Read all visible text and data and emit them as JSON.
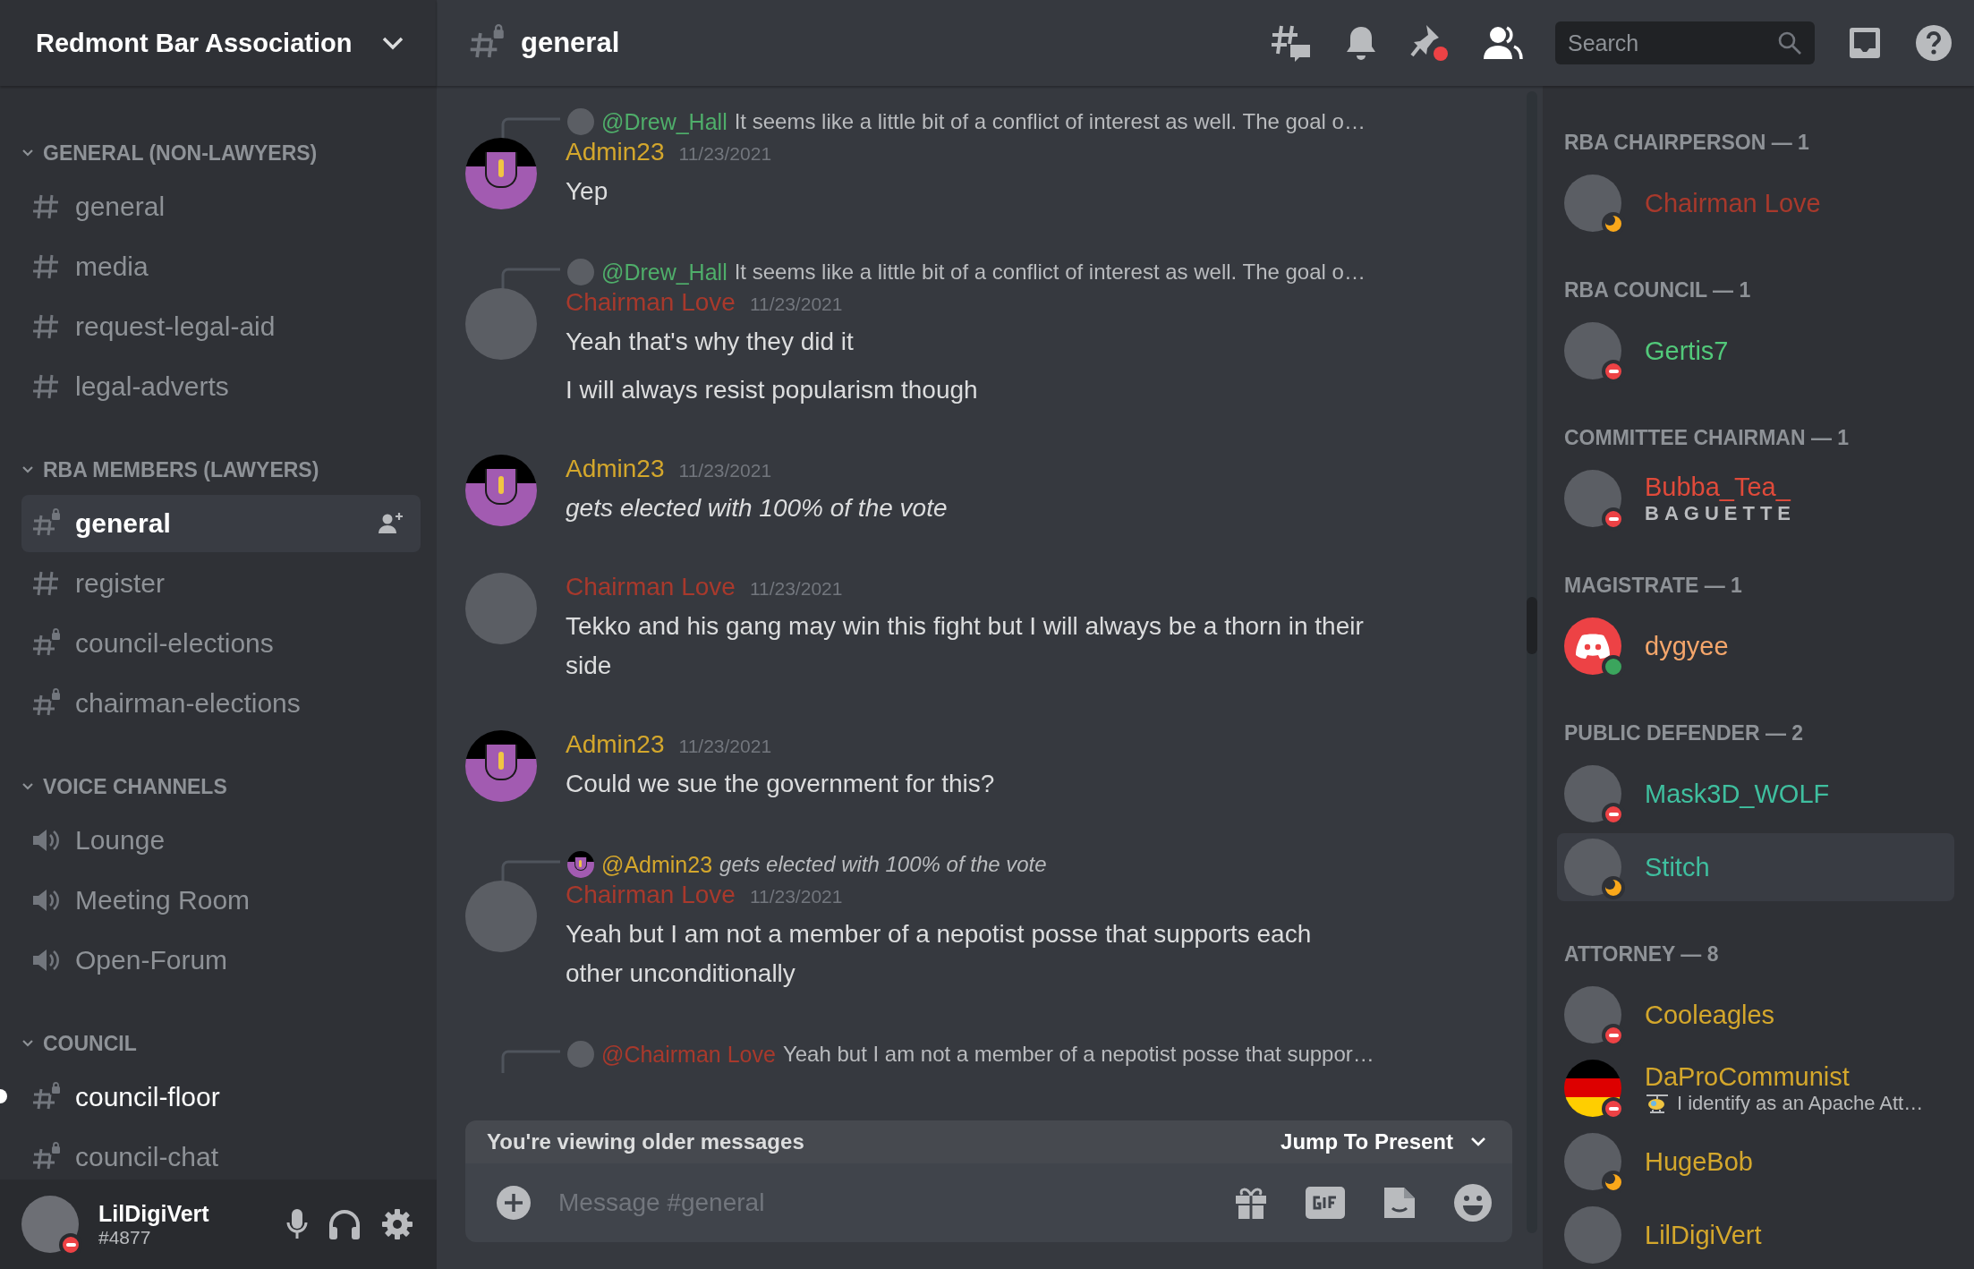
{
  "server": {
    "name": "Redmont Bar Association"
  },
  "channel_header": {
    "name": "general",
    "search_placeholder": "Search"
  },
  "categories": [
    {
      "name": "GENERAL (NON-LAWYERS)",
      "expanded": true,
      "channels": [
        {
          "name": "general",
          "kind": "text",
          "selected": false,
          "unread": false
        },
        {
          "name": "media",
          "kind": "text",
          "selected": false,
          "unread": false
        },
        {
          "name": "request-legal-aid",
          "kind": "text",
          "selected": false,
          "unread": false
        },
        {
          "name": "legal-adverts",
          "kind": "text",
          "selected": false,
          "unread": false
        }
      ]
    },
    {
      "name": "RBA MEMBERS (LAWYERS)",
      "expanded": true,
      "channels": [
        {
          "name": "general",
          "kind": "private",
          "selected": true,
          "unread": false
        },
        {
          "name": "register",
          "kind": "text",
          "selected": false,
          "unread": false
        },
        {
          "name": "council-elections",
          "kind": "private",
          "selected": false,
          "unread": false
        },
        {
          "name": "chairman-elections",
          "kind": "private",
          "selected": false,
          "unread": false
        }
      ]
    },
    {
      "name": "VOICE CHANNELS",
      "expanded": true,
      "channels": [
        {
          "name": "Lounge",
          "kind": "voice",
          "selected": false,
          "unread": false
        },
        {
          "name": "Meeting Room",
          "kind": "voice",
          "selected": false,
          "unread": false
        },
        {
          "name": "Open-Forum",
          "kind": "voice",
          "selected": false,
          "unread": false
        }
      ]
    },
    {
      "name": "COUNCIL",
      "expanded": true,
      "channels": [
        {
          "name": "council-floor",
          "kind": "private",
          "selected": false,
          "unread": true
        },
        {
          "name": "council-chat",
          "kind": "private",
          "selected": false,
          "unread": false
        }
      ]
    }
  ],
  "user": {
    "name": "LilDigiVert",
    "tag": "#4877",
    "status": {
      "kind": "dnd",
      "color": "#ed4245"
    }
  },
  "messages": [
    {
      "reply": {
        "author": "@Drew_Hall",
        "color": "#4fae6a",
        "text": "It seems like a little bit of a conflict of interest as well. The goal o…",
        "italic": false,
        "avatar": {
          "kind": "photo"
        }
      },
      "author": "Admin23",
      "color": "#d4a72c",
      "avatar": {
        "kind": "emblem"
      },
      "date": "11/23/2021",
      "italic": false,
      "lines": [
        "Yep"
      ]
    },
    {
      "reply": {
        "author": "@Drew_Hall",
        "color": "#4fae6a",
        "text": "It seems like a little bit of a conflict of interest as well. The goal o…",
        "italic": false,
        "avatar": {
          "kind": "photo"
        }
      },
      "author": "Chairman Love",
      "color": "#a8392c",
      "avatar": {
        "kind": "photo"
      },
      "date": "11/23/2021",
      "italic": false,
      "lines": [
        "Yeah that's why they did it",
        "I will always resist popularism though"
      ]
    },
    {
      "author": "Admin23",
      "color": "#d4a72c",
      "avatar": {
        "kind": "emblem"
      },
      "date": "11/23/2021",
      "italic": true,
      "lines": [
        "gets elected with 100% of the vote"
      ]
    },
    {
      "author": "Chairman Love",
      "color": "#a8392c",
      "avatar": {
        "kind": "photo"
      },
      "date": "11/23/2021",
      "italic": false,
      "lines": [
        "Tekko and his gang may win this fight but I will always be a thorn in their side"
      ]
    },
    {
      "author": "Admin23",
      "color": "#d4a72c",
      "avatar": {
        "kind": "emblem"
      },
      "date": "11/23/2021",
      "italic": false,
      "lines": [
        "Could we sue the government for this?"
      ]
    },
    {
      "reply": {
        "author": "@Admin23",
        "color": "#d4a72c",
        "text": "gets elected with 100% of the vote",
        "italic": true,
        "avatar": {
          "kind": "emblem"
        }
      },
      "author": "Chairman Love",
      "color": "#a8392c",
      "avatar": {
        "kind": "photo"
      },
      "date": "11/23/2021",
      "italic": false,
      "lines": [
        "Yeah but I am not a member of a nepotist posse that supports each other unconditionally"
      ]
    },
    {
      "reply": {
        "author": "@Chairman Love",
        "color": "#a8392c",
        "text": "Yeah but I am not a member of a nepotist posse that suppor…",
        "italic": false,
        "avatar": {
          "kind": "photo"
        }
      }
    }
  ],
  "older_messages_bar": {
    "text": "You're viewing older messages",
    "action": "Jump To Present"
  },
  "composer": {
    "placeholder": "Message #general"
  },
  "member_groups": [
    {
      "title": "RBA CHAIRPERSON — 1",
      "members": [
        {
          "name": "Chairman Love",
          "color": "#a8392c",
          "status": {
            "kind": "idle",
            "color": "#faa81a"
          },
          "avatar": {
            "kind": "photo"
          },
          "selected": false
        }
      ]
    },
    {
      "title": "RBA COUNCIL — 1",
      "members": [
        {
          "name": "Gertis7",
          "color": "#52c97a",
          "status": {
            "kind": "dnd",
            "color": "#ed4245"
          },
          "avatar": {
            "kind": "photo"
          },
          "selected": false
        }
      ]
    },
    {
      "title": "COMMITTEE CHAIRMAN — 1",
      "members": [
        {
          "name": "Bubba_Tea_",
          "color": "#e04a3a",
          "status": {
            "kind": "dnd",
            "color": "#ed4245"
          },
          "avatar": {
            "kind": "photo"
          },
          "selected": false,
          "activity": "BAGUETTE",
          "activity_emoji": false
        }
      ]
    },
    {
      "title": "MAGISTRATE — 1",
      "members": [
        {
          "name": "dygyee",
          "color": "#f5a66b",
          "status": {
            "kind": "online",
            "color": "#3ba55d"
          },
          "avatar": {
            "kind": "default"
          },
          "selected": false
        }
      ]
    },
    {
      "title": "PUBLIC DEFENDER — 2",
      "members": [
        {
          "name": "Mask3D_WOLF",
          "color": "#3fbf9f",
          "status": {
            "kind": "dnd",
            "color": "#ed4245"
          },
          "avatar": {
            "kind": "photo"
          },
          "selected": false
        },
        {
          "name": "Stitch",
          "color": "#3fbf9f",
          "status": {
            "kind": "idle",
            "color": "#faa81a"
          },
          "avatar": {
            "kind": "photo"
          },
          "selected": true
        }
      ]
    },
    {
      "title": "ATTORNEY — 8",
      "members": [
        {
          "name": "Cooleagles",
          "color": "#d4a72c",
          "status": {
            "kind": "dnd",
            "color": "#ed4245"
          },
          "avatar": {
            "kind": "photo"
          },
          "selected": false
        },
        {
          "name": "DaProCommunist",
          "color": "#d4a72c",
          "status": {
            "kind": "dnd",
            "color": "#ed4245"
          },
          "avatar": {
            "kind": "flag"
          },
          "selected": false,
          "activity": "I identify as an Apache Att…",
          "activity_emoji": true
        },
        {
          "name": "HugeBob",
          "color": "#d4a72c",
          "status": {
            "kind": "idle",
            "color": "#faa81a"
          },
          "avatar": {
            "kind": "photo"
          },
          "selected": false
        },
        {
          "name": "LilDigiVert",
          "color": "#d4a72c",
          "avatar": {
            "kind": "photo"
          },
          "selected": false
        }
      ]
    }
  ]
}
